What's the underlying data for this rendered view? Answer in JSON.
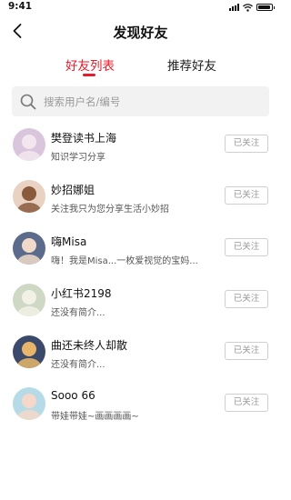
{
  "status_bar": {
    "time": "9:41",
    "icons": [
      "signal-icon",
      "wifi-icon",
      "battery-icon"
    ],
    "battery_level": 0.9
  },
  "nav": {
    "back_icon": "chevron-left-icon",
    "title": "发现好友"
  },
  "tabs": [
    {
      "label": "好友列表",
      "active": true
    },
    {
      "label": "推荐好友",
      "active": false
    }
  ],
  "search": {
    "icon": "search-icon",
    "placeholder": "搜索用户名/编号",
    "value": ""
  },
  "colors": {
    "accent": "#e31b2b",
    "search_bg": "#f2f2f2",
    "button_border": "#cfcfcf",
    "button_text": "#999999"
  },
  "friends": [
    {
      "name": "樊登读书上海",
      "desc": "知识学习分享",
      "button": "已关注",
      "avatar_bg": "#d9c6dc",
      "avatar_fg": "#f3e6ef"
    },
    {
      "name": "妙招娜姐",
      "desc": "关注我只为您分享生活小妙招",
      "button": "已关注",
      "avatar_bg": "#e9d2c2",
      "avatar_fg": "#8a5a3c"
    },
    {
      "name": "嗨Misa",
      "desc": "嗨！我是Misa...一枚爱视觉的宝妈...",
      "button": "已关注",
      "avatar_bg": "#5a6b8c",
      "avatar_fg": "#f0d9c8"
    },
    {
      "name": "小红书2198",
      "desc": "还没有简介...",
      "button": "已关注",
      "avatar_bg": "#cfd8c4",
      "avatar_fg": "#f3f1e6"
    },
    {
      "name": "曲还未终人却散",
      "desc": "还没有简介...",
      "button": "已关注",
      "avatar_bg": "#3b4a6b",
      "avatar_fg": "#e8b66a"
    },
    {
      "name": "Sooo 66",
      "desc": "带娃带娃~画画画画~",
      "button": "已关注",
      "avatar_bg": "#b7dbe6",
      "avatar_fg": "#f5d8c9"
    }
  ]
}
